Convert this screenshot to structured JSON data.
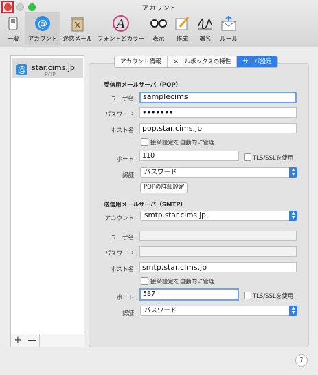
{
  "window": {
    "title": "アカウント"
  },
  "toolbar": {
    "items": [
      {
        "label": "一般",
        "icon": "switch-icon"
      },
      {
        "label": "アカウント",
        "icon": "at-icon"
      },
      {
        "label": "迷惑メール",
        "icon": "trash-icon"
      },
      {
        "label": "フォントとカラー",
        "icon": "font-icon"
      },
      {
        "label": "表示",
        "icon": "glasses-icon"
      },
      {
        "label": "作成",
        "icon": "pencil-icon"
      },
      {
        "label": "署名",
        "icon": "signature-icon"
      },
      {
        "label": "ルール",
        "icon": "rules-icon"
      }
    ]
  },
  "sidebar": {
    "account": {
      "name": "star.cims.jp",
      "type": "POP"
    },
    "add": "+",
    "remove": "—"
  },
  "tabs": {
    "info": "アカウント情報",
    "mailbox": "メールボックスの特性",
    "server": "サーバ設定"
  },
  "incoming": {
    "heading": "受信用メールサーバ（POP）",
    "user_label": "ユーザ名:",
    "user": "samplecims",
    "pass_label": "パスワード:",
    "pass": "•••••••",
    "host_label": "ホスト名:",
    "host": "pop.star.cims.jp",
    "auto_label": "接続設定を自動的に管理",
    "port_label": "ポート:",
    "port": "110",
    "tls_label": "TLS/SSLを使用",
    "auth_label": "認証:",
    "auth": "パスワード",
    "advanced": "POPの詳細設定"
  },
  "outgoing": {
    "heading": "送信用メールサーバ（SMTP）",
    "account_label": "アカウント:",
    "account": "smtp.star.cims.jp",
    "user_label": "ユーザ名:",
    "pass_label": "パスワード:",
    "host_label": "ホスト名:",
    "host": "smtp.star.cims.jp",
    "auto_label": "接続設定を自動的に管理",
    "port_label": "ポート:",
    "port": "587",
    "tls_label": "TLS/SSLを使用",
    "auth_label": "認証:",
    "auth": "パスワード"
  },
  "help": "?",
  "colors": {
    "accent": "#2f7fe6",
    "close": "#e0443e",
    "maximize": "#2ac33f"
  }
}
